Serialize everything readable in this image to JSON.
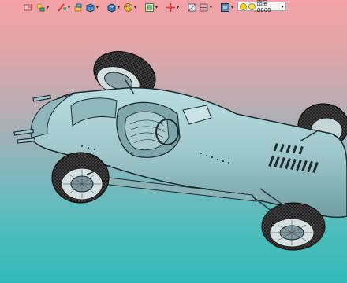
{
  "viewport": {
    "background_top": "#f4a2a5",
    "background_bottom": "#35b9b7",
    "model_color": "#9fc8cc",
    "model_edge_color": "#2a3a3d"
  },
  "toolbar": {
    "icons": [
      {
        "name": "layer-manager-icon",
        "dropdown": false
      },
      {
        "name": "layer-state-icon",
        "dropdown": true
      },
      {
        "name": "sketch-icon",
        "dropdown": true
      },
      {
        "name": "extrude-icon",
        "dropdown": false
      },
      {
        "name": "box-icon",
        "dropdown": true
      },
      {
        "name": "view-cube-icon",
        "dropdown": true
      },
      {
        "name": "appearance-icon",
        "dropdown": true
      },
      {
        "name": "display-style-icon",
        "dropdown": true
      },
      {
        "name": "move-icon",
        "dropdown": true
      },
      {
        "name": "section-icon",
        "dropdown": false
      },
      {
        "name": "frame-icon",
        "dropdown": true
      },
      {
        "name": "view-orientation-icon",
        "dropdown": true
      },
      {
        "name": "line-weight-icon",
        "dropdown": false
      },
      {
        "name": "plane-icon",
        "dropdown": false
      },
      {
        "name": "camera-icon",
        "dropdown": true
      }
    ],
    "layer_select": {
      "value": "图层0000",
      "bulb_color": "#f4d820",
      "light_color": "#f0e060"
    }
  }
}
